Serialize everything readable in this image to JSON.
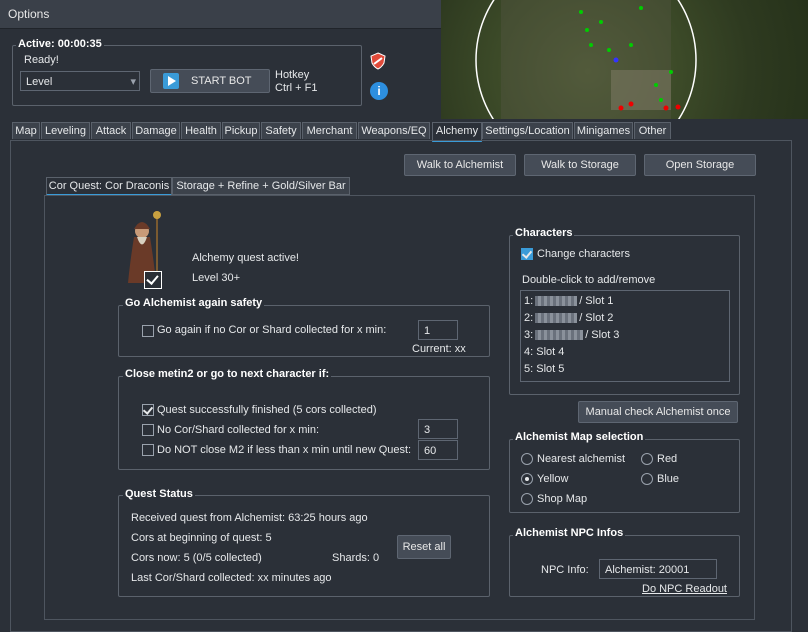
{
  "window": {
    "title": "Options"
  },
  "status": {
    "active": "Active: 00:00:35",
    "ready": "Ready!",
    "mode_selected": "Level",
    "start_label": "START BOT",
    "hotkey_line1": "Hotkey",
    "hotkey_line2": "Ctrl + F1"
  },
  "tabs": [
    "Map",
    "Leveling",
    "Attack",
    "Damage",
    "Health",
    "Pickup",
    "Safety",
    "Merchant",
    "Weapons/EQ",
    "Alchemy",
    "Settings/Location",
    "Minigames",
    "Other"
  ],
  "actions": {
    "walk_alchemist": "Walk to Alchemist",
    "walk_storage": "Walk to Storage",
    "open_storage": "Open Storage"
  },
  "subtabs": [
    "Cor Quest: Cor Draconis",
    "Storage + Refine + Gold/Silver Bar"
  ],
  "quest_header": {
    "active": "Alchemy quest active!",
    "level": "Level 30+"
  },
  "safety": {
    "title": "Go Alchemist again safety",
    "checkbox": "Go again if no Cor or Shard collected for x min:",
    "value": "1",
    "current": "Current: xx"
  },
  "close": {
    "title": "Close metin2 or go to next character if:",
    "opt1": "Quest successfully finished (5 cors collected)",
    "opt2": "No Cor/Shard collected for x min:",
    "opt2_value": "3",
    "opt3": "Do NOT close M2 if less than x min until new Quest:",
    "opt3_value": "60"
  },
  "quest_status": {
    "title": "Quest Status",
    "received": "Received quest from Alchemist: 63:25 hours ago",
    "cors_begin": "Cors at beginning of quest: 5",
    "cors_now": "Cors now: 5 (0/5 collected)",
    "shards": "Shards: 0",
    "last": "Last Cor/Shard collected: xx minutes ago",
    "reset": "Reset all"
  },
  "characters": {
    "title": "Characters",
    "change": "Change characters",
    "hint": "Double-click to add/remove",
    "slots": [
      {
        "prefix": "1:",
        "suffix": "/ Slot 1"
      },
      {
        "prefix": "2:",
        "suffix": "/ Slot 2"
      },
      {
        "prefix": "3:",
        "suffix": "/ Slot 3"
      },
      {
        "prefix": "4: Slot 4",
        "suffix": ""
      },
      {
        "prefix": "5: Slot 5",
        "suffix": ""
      }
    ]
  },
  "manual_check": "Manual check Alchemist once",
  "map_selection": {
    "title": "Alchemist Map selection",
    "nearest": "Nearest alchemist",
    "red": "Red",
    "yellow": "Yellow",
    "blue": "Blue",
    "shop": "Shop Map"
  },
  "npc": {
    "title": "Alchemist NPC Infos",
    "label": "NPC Info:",
    "value": "Alchemist: 20001",
    "readout": "Do NPC Readout"
  },
  "colors": {
    "accent": "#3a9bd8",
    "bg": "#2b3038"
  }
}
